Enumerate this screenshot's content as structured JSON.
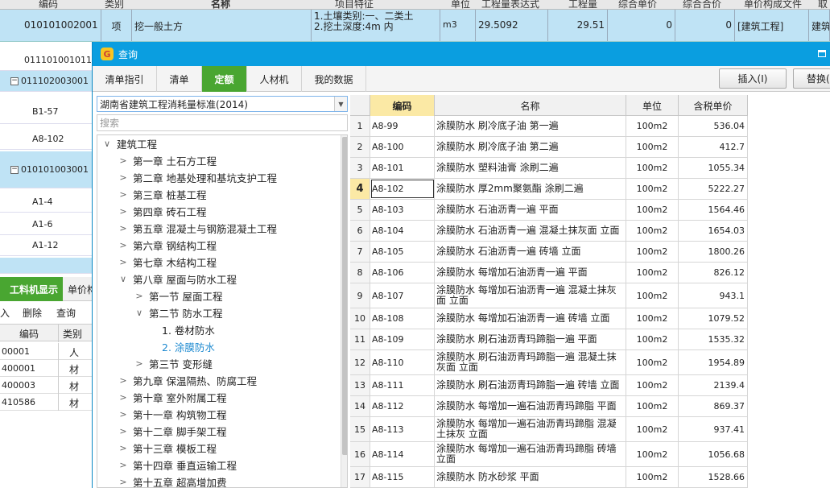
{
  "bg": {
    "headers": [
      "编码",
      "类别",
      "名称",
      "项目特征",
      "单位",
      "工程量表达式",
      "工程量",
      "综合单价",
      "综合合价",
      "单价构成文件",
      "取"
    ],
    "row": {
      "code": "010101002001",
      "type": "项",
      "name": "挖一般土方",
      "feature1": "1.土壤类别:一、二类土",
      "feature2": "2.挖土深度:4m 内",
      "unit": "m3",
      "expr": "29.5092",
      "qty": "29.51",
      "unit_price": "0",
      "total": "0",
      "file": "[建筑工程]",
      "extra": "建筑"
    },
    "tree_rows": [
      {
        "label": "011101001011",
        "box": ""
      },
      {
        "label": "011102003001",
        "box": "−"
      },
      {
        "label": "B1-57",
        "box": ""
      },
      {
        "label": "A8-102",
        "box": ""
      },
      {
        "label": "010101003001",
        "box": "−"
      },
      {
        "label": "A1-4",
        "box": ""
      },
      {
        "label": "A1-6",
        "box": ""
      },
      {
        "label": "A1-12",
        "box": ""
      }
    ],
    "lower_tabs": [
      "工料机显示",
      "单价构"
    ],
    "lower_actions": [
      "插入",
      "删除",
      "查询"
    ],
    "lower_headers": [
      "编码",
      "类别"
    ],
    "lower_rows": [
      {
        "code": "00001",
        "type": "人"
      },
      {
        "code": "400001",
        "type": "材"
      },
      {
        "code": "400003",
        "type": "材"
      },
      {
        "code": "410586",
        "type": "材"
      }
    ]
  },
  "dialog": {
    "title": "查询",
    "tabs": [
      "清单指引",
      "清单",
      "定额",
      "人材机",
      "我的数据"
    ],
    "active_tab": "定额",
    "insert_button": "插入(I)",
    "replace_button": "替换(",
    "standard": "湖南省建筑工程消耗量标准(2014)",
    "search_placeholder": "搜索",
    "tree": [
      {
        "label": "建筑工程",
        "level": 0,
        "chev": "∨"
      },
      {
        "label": "第一章 土石方工程",
        "level": 1,
        "chev": ">"
      },
      {
        "label": "第二章 地基处理和基坑支护工程",
        "level": 1,
        "chev": ">"
      },
      {
        "label": "第三章 桩基工程",
        "level": 1,
        "chev": ">"
      },
      {
        "label": "第四章 砖石工程",
        "level": 1,
        "chev": ">"
      },
      {
        "label": "第五章 混凝土与钢筋混凝土工程",
        "level": 1,
        "chev": ">"
      },
      {
        "label": "第六章 钢结构工程",
        "level": 1,
        "chev": ">"
      },
      {
        "label": "第七章 木结构工程",
        "level": 1,
        "chev": ">"
      },
      {
        "label": "第八章 屋面与防水工程",
        "level": 1,
        "chev": "∨"
      },
      {
        "label": "第一节 屋面工程",
        "level": 2,
        "chev": ">"
      },
      {
        "label": "第二节 防水工程",
        "level": 2,
        "chev": "∨"
      },
      {
        "label": "1. 卷材防水",
        "level": 3,
        "chev": ""
      },
      {
        "label": "2. 涂膜防水",
        "level": 3,
        "chev": "",
        "selected": true
      },
      {
        "label": "第三节 变形缝",
        "level": 2,
        "chev": ">"
      },
      {
        "label": "第九章 保温隔热、防腐工程",
        "level": 1,
        "chev": ">"
      },
      {
        "label": "第十章 室外附属工程",
        "level": 1,
        "chev": ">"
      },
      {
        "label": "第十一章 构筑物工程",
        "level": 1,
        "chev": ">"
      },
      {
        "label": "第十二章 脚手架工程",
        "level": 1,
        "chev": ">"
      },
      {
        "label": "第十三章 模板工程",
        "level": 1,
        "chev": ">"
      },
      {
        "label": "第十四章 垂直运输工程",
        "level": 1,
        "chev": ">"
      },
      {
        "label": "第十五章 超高增加费",
        "level": 1,
        "chev": ">"
      }
    ],
    "grid_headers": [
      "",
      "编码",
      "名称",
      "单位",
      "含税单价"
    ],
    "rows": [
      {
        "n": "1",
        "code": "A8-99",
        "name": "涂膜防水 刷冷底子油 第一遍",
        "unit": "100m2",
        "price": "536.04"
      },
      {
        "n": "2",
        "code": "A8-100",
        "name": "涂膜防水 刷冷底子油 第二遍",
        "unit": "100m2",
        "price": "412.7"
      },
      {
        "n": "3",
        "code": "A8-101",
        "name": "涂膜防水 塑料油膏 涂刷二遍",
        "unit": "100m2",
        "price": "1055.34"
      },
      {
        "n": "4",
        "code": "A8-102",
        "name": "涂膜防水 厚2mm聚氨酯 涂刷二遍",
        "unit": "100m2",
        "price": "5222.27",
        "current": true
      },
      {
        "n": "5",
        "code": "A8-103",
        "name": "涂膜防水 石油沥青一遍 平面",
        "unit": "100m2",
        "price": "1564.46"
      },
      {
        "n": "6",
        "code": "A8-104",
        "name": "涂膜防水 石油沥青一遍 混凝土抹灰面 立面",
        "unit": "100m2",
        "price": "1654.03"
      },
      {
        "n": "7",
        "code": "A8-105",
        "name": "涂膜防水 石油沥青一遍 砖墙 立面",
        "unit": "100m2",
        "price": "1800.26"
      },
      {
        "n": "8",
        "code": "A8-106",
        "name": "涂膜防水 每增加石油沥青一遍 平面",
        "unit": "100m2",
        "price": "826.12"
      },
      {
        "n": "9",
        "code": "A8-107",
        "name": "涂膜防水 每增加石油沥青一遍 混凝土抹灰面 立面",
        "unit": "100m2",
        "price": "943.1"
      },
      {
        "n": "10",
        "code": "A8-108",
        "name": "涂膜防水 每增加石油沥青一遍 砖墙 立面",
        "unit": "100m2",
        "price": "1079.52"
      },
      {
        "n": "11",
        "code": "A8-109",
        "name": "涂膜防水 刷石油沥青玛蹄脂一遍 平面",
        "unit": "100m2",
        "price": "1535.32"
      },
      {
        "n": "12",
        "code": "A8-110",
        "name": "涂膜防水 刷石油沥青玛蹄脂一遍 混凝土抹灰面 立面",
        "unit": "100m2",
        "price": "1954.89"
      },
      {
        "n": "13",
        "code": "A8-111",
        "name": "涂膜防水 刷石油沥青玛蹄脂一遍 砖墙 立面",
        "unit": "100m2",
        "price": "2139.4"
      },
      {
        "n": "14",
        "code": "A8-112",
        "name": "涂膜防水 每增加一遍石油沥青玛蹄脂 平面",
        "unit": "100m2",
        "price": "869.37"
      },
      {
        "n": "15",
        "code": "A8-113",
        "name": "涂膜防水 每增加一遍石油沥青玛蹄脂 混凝土抹灰 立面",
        "unit": "100m2",
        "price": "937.41"
      },
      {
        "n": "16",
        "code": "A8-114",
        "name": "涂膜防水 每增加一遍石油沥青玛蹄脂 砖墙立面",
        "unit": "100m2",
        "price": "1056.68"
      },
      {
        "n": "17",
        "code": "A8-115",
        "name": "涂膜防水 防水砂浆 平面",
        "unit": "100m2",
        "price": "1528.66"
      }
    ]
  }
}
